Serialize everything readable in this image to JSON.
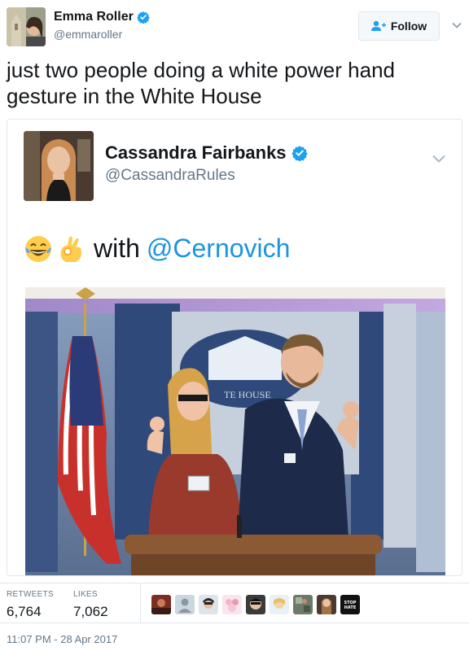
{
  "author": {
    "name": "Emma Roller",
    "handle": "@emmaroller"
  },
  "follow_label": "Follow",
  "tweet_text": "just two people doing a white power hand gesture in the White House",
  "quoted": {
    "name": "Cassandra Fairbanks",
    "handle": "@CassandraRules",
    "text_word": "with",
    "mention": "@Cernovich",
    "emojis": [
      "laughing-crying-emoji",
      "ok-hand-emoji"
    ],
    "photo_sign_text": "TE HOUSE"
  },
  "stats": {
    "retweets_label": "RETWEETS",
    "retweets_value": "6,764",
    "likes_label": "LIKES",
    "likes_value": "7,062"
  },
  "liker_badge_text": "STOP HATE",
  "timestamp": "11:07 PM - 28 Apr 2017",
  "colors": {
    "verified": "#1da1f2",
    "link": "#1b95e0",
    "muted": "#657786"
  }
}
